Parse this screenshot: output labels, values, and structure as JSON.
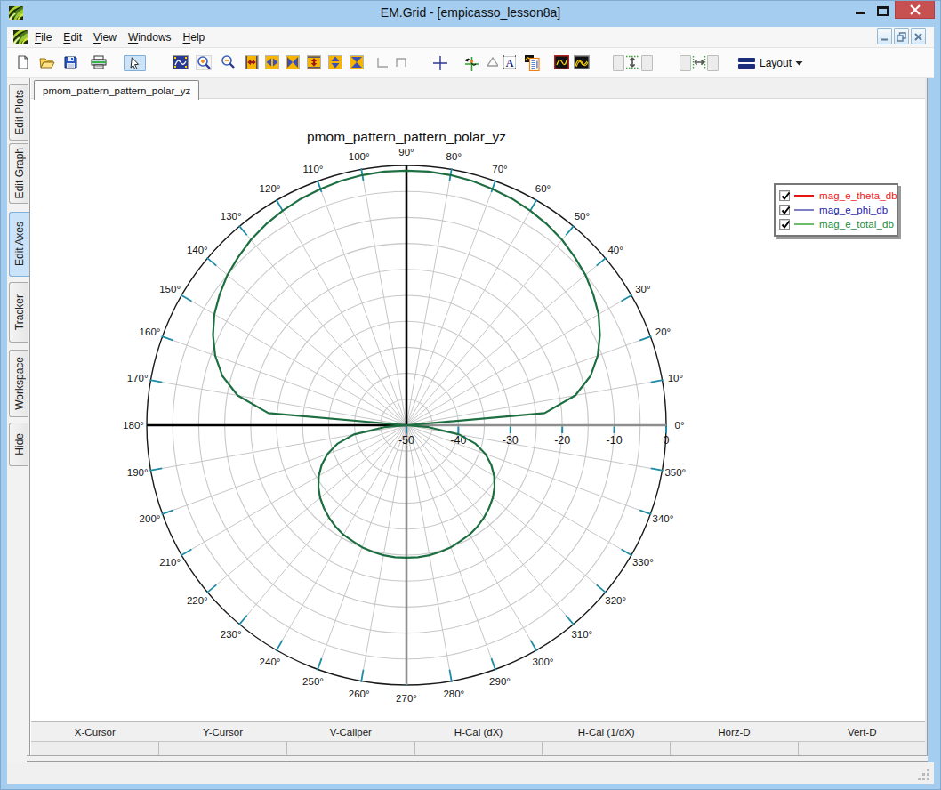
{
  "window": {
    "title": "EM.Grid - [empicasso_lesson8a]"
  },
  "menu": {
    "items": [
      {
        "label": "File",
        "underline_index": 0
      },
      {
        "label": "Edit",
        "underline_index": 0
      },
      {
        "label": "View",
        "underline_index": 0
      },
      {
        "label": "Windows",
        "underline_index": 0
      },
      {
        "label": "Help",
        "underline_index": 0
      }
    ]
  },
  "toolbar": {
    "layout_label": "Layout",
    "icons": [
      "new-document-icon",
      "open-file-icon",
      "save-icon",
      "print-icon",
      "pointer-tool-icon",
      "fit-plot-icon",
      "zoom-in-icon",
      "zoom-out-icon",
      "expand-x-icon",
      "shrink-x-icon",
      "compress-x-icon",
      "expand-y-icon",
      "shrink-y-icon",
      "compress-y-icon",
      "corner-bottom-icon",
      "corner-top-icon",
      "crosshair-icon",
      "tracker-tool-icon",
      "triangle-marker-icon",
      "text-label-icon",
      "plot-report-icon",
      "plot-window-icon",
      "plots-overlay-icon",
      "fit-height-left-icon",
      "fit-height-icon",
      "fit-height-right-icon",
      "fit-width-left-icon",
      "fit-width-icon",
      "fit-width-right-icon",
      "layout-icon"
    ]
  },
  "sidebar": {
    "items": [
      {
        "label": "Edit Plots",
        "selected": false
      },
      {
        "label": "Edit Graph",
        "selected": false
      },
      {
        "label": "Edit Axes",
        "selected": true
      },
      {
        "label": "Tracker",
        "selected": false
      },
      {
        "label": "Workspace",
        "selected": false
      },
      {
        "label": "Hide",
        "selected": false
      }
    ]
  },
  "tab": {
    "label": "pmom_pattern_pattern_polar_yz"
  },
  "legend": {
    "entries": [
      {
        "label": "mag_e_theta_db",
        "checked": true,
        "line_color": "#e81414",
        "text_color": "#ee2222",
        "line_weight": 3
      },
      {
        "label": "mag_e_phi_db",
        "checked": true,
        "line_color": "#7e7ec6",
        "text_color": "#2222a8",
        "line_weight": 2
      },
      {
        "label": "mag_e_total_db",
        "checked": true,
        "line_color": "#6cbd6c",
        "text_color": "#1d8d3a",
        "line_weight": 2
      }
    ]
  },
  "cursor_bar": {
    "columns": [
      "X-Cursor",
      "Y-Cursor",
      "V-Caliper",
      "H-Cal (dX)",
      "H-Cal (1/dX)",
      "Horz-D",
      "Vert-D"
    ]
  },
  "chart_data": {
    "type": "line",
    "subtype": "polar",
    "title": "pmom_pattern_pattern_polar_yz",
    "radial_axis": {
      "min": -50,
      "max": 0,
      "label_step": 10,
      "grid_step": 5,
      "tick_labels": [
        "-50",
        "-40",
        "-30",
        "-20",
        "-10",
        "0"
      ]
    },
    "angle_axis": {
      "step_deg": 10,
      "label_suffix": "°",
      "labels": [
        "0°",
        "10°",
        "20°",
        "30°",
        "40°",
        "50°",
        "60°",
        "70°",
        "80°",
        "90°",
        "100°",
        "110°",
        "120°",
        "130°",
        "140°",
        "150°",
        "160°",
        "170°",
        "180°",
        "190°",
        "200°",
        "210°",
        "220°",
        "230°",
        "240°",
        "250°",
        "260°",
        "270°",
        "280°",
        "290°",
        "300°",
        "310°",
        "320°",
        "330°",
        "340°",
        "350°"
      ]
    },
    "legend_position": "right",
    "grid": true,
    "series": [
      {
        "name": "mag_e_theta_db",
        "color": "#e81414",
        "visible": true
      },
      {
        "name": "mag_e_phi_db",
        "color": "#8585c4",
        "visible": true
      },
      {
        "name": "mag_e_total_db",
        "color": "#1d6f41",
        "visible": true,
        "points_deg_db": [
          [
            0,
            -50.0
          ],
          [
            5,
            -23.3
          ],
          [
            10,
            -17.0
          ],
          [
            15,
            -13.3
          ],
          [
            20,
            -10.8
          ],
          [
            25,
            -8.9
          ],
          [
            30,
            -7.3
          ],
          [
            35,
            -6.1
          ],
          [
            40,
            -5.0
          ],
          [
            45,
            -4.2
          ],
          [
            50,
            -3.4
          ],
          [
            55,
            -2.8
          ],
          [
            60,
            -2.3
          ],
          [
            65,
            -1.9
          ],
          [
            70,
            -1.6
          ],
          [
            75,
            -1.3
          ],
          [
            80,
            -1.1
          ],
          [
            85,
            -1.0
          ],
          [
            90,
            -1.0
          ],
          [
            95,
            -1.0
          ],
          [
            100,
            -1.1
          ],
          [
            105,
            -1.3
          ],
          [
            110,
            -1.6
          ],
          [
            115,
            -1.9
          ],
          [
            120,
            -2.3
          ],
          [
            125,
            -2.8
          ],
          [
            130,
            -3.4
          ],
          [
            135,
            -4.2
          ],
          [
            140,
            -5.0
          ],
          [
            145,
            -6.1
          ],
          [
            150,
            -7.3
          ],
          [
            155,
            -8.9
          ],
          [
            160,
            -10.8
          ],
          [
            165,
            -13.3
          ],
          [
            170,
            -17.0
          ],
          [
            175,
            -23.3
          ],
          [
            180,
            -50.0
          ],
          [
            185,
            -45.7
          ],
          [
            190,
            -39.7
          ],
          [
            195,
            -36.2
          ],
          [
            200,
            -33.8
          ],
          [
            205,
            -32.0
          ],
          [
            210,
            -30.5
          ],
          [
            215,
            -29.3
          ],
          [
            220,
            -28.3
          ],
          [
            225,
            -27.5
          ],
          [
            230,
            -26.8
          ],
          [
            235,
            -26.2
          ],
          [
            240,
            -25.7
          ],
          [
            245,
            -25.4
          ],
          [
            250,
            -25.0
          ],
          [
            255,
            -24.8
          ],
          [
            260,
            -24.6
          ],
          [
            265,
            -24.5
          ],
          [
            270,
            -24.5
          ],
          [
            275,
            -24.5
          ],
          [
            280,
            -24.6
          ],
          [
            285,
            -24.8
          ],
          [
            290,
            -25.0
          ],
          [
            295,
            -25.4
          ],
          [
            300,
            -25.7
          ],
          [
            305,
            -26.2
          ],
          [
            310,
            -26.8
          ],
          [
            315,
            -27.5
          ],
          [
            320,
            -28.3
          ],
          [
            325,
            -29.3
          ],
          [
            330,
            -30.5
          ],
          [
            335,
            -32.0
          ],
          [
            340,
            -33.8
          ],
          [
            345,
            -36.2
          ],
          [
            350,
            -39.7
          ],
          [
            355,
            -45.7
          ],
          [
            360,
            -50.0
          ]
        ]
      }
    ]
  },
  "colors": {
    "frame_blue": "#a4cdf0",
    "close_red": "#c75050",
    "curve_green": "#1d6f41",
    "tick_teal": "#1f8ca8",
    "selected_tab_blue": "#cbe3f8"
  }
}
